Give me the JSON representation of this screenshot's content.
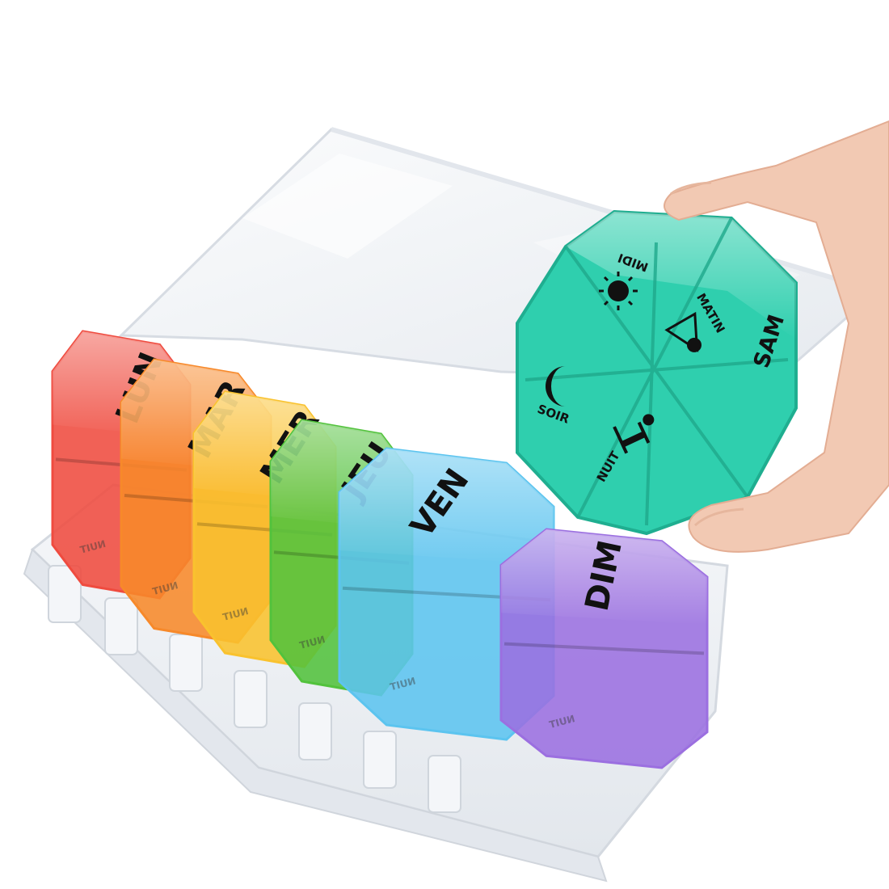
{
  "pill_organizer": {
    "days": [
      {
        "label": "LUN",
        "color": "#ef4b3f"
      },
      {
        "label": "MAR",
        "color": "#f7892a"
      },
      {
        "label": "MER",
        "color": "#f9c22e"
      },
      {
        "label": "JEU",
        "color": "#52c23c"
      },
      {
        "label": "VEN",
        "color": "#5cc4ef"
      },
      {
        "label": "SAM",
        "color": "#2fcfae"
      },
      {
        "label": "DIM",
        "color": "#9b6fe0"
      }
    ],
    "held_case": {
      "day": "SAM",
      "slots": [
        {
          "label": "MATIN",
          "icon": "sunrise-icon"
        },
        {
          "label": "MIDI",
          "icon": "sun-icon"
        },
        {
          "label": "SOIR",
          "icon": "moon-icon"
        },
        {
          "label": "NUIT",
          "icon": "bed-icon"
        }
      ]
    },
    "mirrored_slot_label": "NUIT",
    "colors": {
      "background": "#ffffff",
      "tray": "#e9edf2",
      "lid": "#f1f3f6",
      "skin": "#f2c9b3"
    }
  }
}
